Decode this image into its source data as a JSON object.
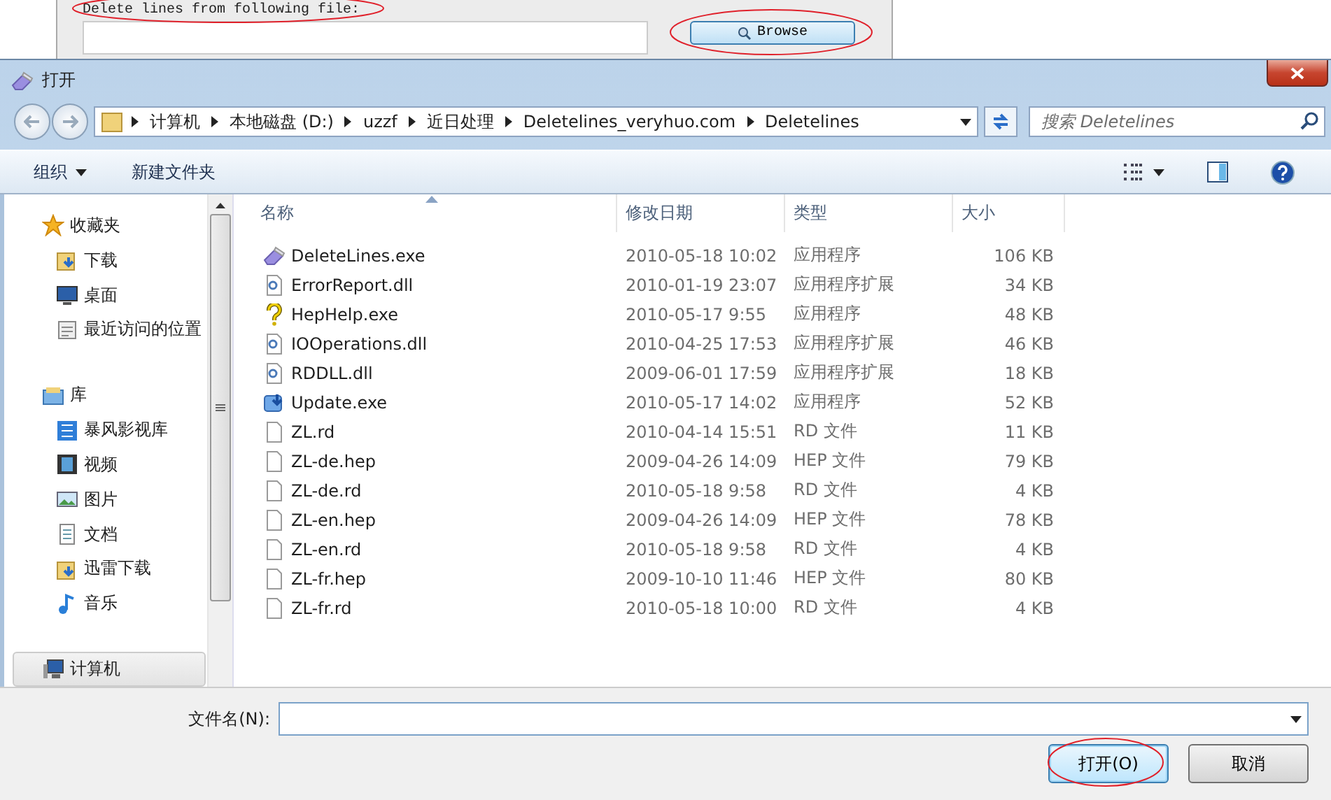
{
  "background_app": {
    "label": "Delete lines from following file:",
    "label_circled": true,
    "browse_button": "Browse",
    "browse_circled": true
  },
  "dialog": {
    "title": "打开",
    "address": [
      "计算机",
      "本地磁盘 (D:)",
      "uzzf",
      "近日处理",
      "Deletelines_veryhuo.com",
      "Deletelines"
    ],
    "search": {
      "placeholder": "搜索 Deletelines"
    },
    "toolbar": {
      "organize": "组织",
      "new_folder": "新建文件夹"
    },
    "nav": [
      {
        "label": "收藏夹",
        "kind": "star",
        "selected": false,
        "children": [
          {
            "label": "下载",
            "kind": "download",
            "selected": false
          },
          {
            "label": "桌面",
            "kind": "desktop",
            "selected": false
          },
          {
            "label": "最近访问的位置",
            "kind": "recent",
            "selected": false
          }
        ]
      },
      {
        "label": "库",
        "kind": "library",
        "selected": false,
        "children": [
          {
            "label": "暴风影视库",
            "kind": "video",
            "selected": false
          },
          {
            "label": "视频",
            "kind": "film",
            "selected": false
          },
          {
            "label": "图片",
            "kind": "image",
            "selected": false
          },
          {
            "label": "文档",
            "kind": "document",
            "selected": false
          },
          {
            "label": "迅雷下载",
            "kind": "download",
            "selected": false
          },
          {
            "label": "音乐",
            "kind": "music",
            "selected": false
          }
        ]
      },
      {
        "label": "计算机",
        "kind": "computer",
        "selected": true
      }
    ],
    "columns": [
      {
        "label": "名称",
        "sorted": true
      },
      {
        "label": "修改日期",
        "sorted": false
      },
      {
        "label": "类型",
        "sorted": false
      },
      {
        "label": "大小",
        "sorted": false
      }
    ],
    "files": [
      {
        "name": "DeleteLines.exe",
        "modified": "2010-05-18 10:02",
        "type": "应用程序",
        "size": "106 KB",
        "kind": "eraser"
      },
      {
        "name": "ErrorReport.dll",
        "modified": "2010-01-19 23:07",
        "type": "应用程序扩展",
        "size": "34 KB",
        "kind": "dll"
      },
      {
        "name": "HepHelp.exe",
        "modified": "2010-05-17 9:55",
        "type": "应用程序",
        "size": "48 KB",
        "kind": "help"
      },
      {
        "name": "IOOperations.dll",
        "modified": "2010-04-25 17:53",
        "type": "应用程序扩展",
        "size": "46 KB",
        "kind": "dll"
      },
      {
        "name": "RDDLL.dll",
        "modified": "2009-06-01 17:59",
        "type": "应用程序扩展",
        "size": "18 KB",
        "kind": "dll"
      },
      {
        "name": "Update.exe",
        "modified": "2010-05-17 14:02",
        "type": "应用程序",
        "size": "52 KB",
        "kind": "update"
      },
      {
        "name": "ZL.rd",
        "modified": "2010-04-14 15:51",
        "type": "RD 文件",
        "size": "11 KB",
        "kind": "blank"
      },
      {
        "name": "ZL-de.hep",
        "modified": "2009-04-26 14:09",
        "type": "HEP 文件",
        "size": "79 KB",
        "kind": "blank"
      },
      {
        "name": "ZL-de.rd",
        "modified": "2010-05-18 9:58",
        "type": "RD 文件",
        "size": "4 KB",
        "kind": "blank"
      },
      {
        "name": "ZL-en.hep",
        "modified": "2009-04-26 14:09",
        "type": "HEP 文件",
        "size": "78 KB",
        "kind": "blank"
      },
      {
        "name": "ZL-en.rd",
        "modified": "2010-05-18 9:58",
        "type": "RD 文件",
        "size": "4 KB",
        "kind": "blank"
      },
      {
        "name": "ZL-fr.hep",
        "modified": "2009-10-10 11:46",
        "type": "HEP 文件",
        "size": "80 KB",
        "kind": "blank"
      },
      {
        "name": "ZL-fr.rd",
        "modified": "2010-05-18 10:00",
        "type": "RD 文件",
        "size": "4 KB",
        "kind": "blank"
      }
    ],
    "filename_label": "文件名(N):",
    "buttons": [
      {
        "label": "打开(O)",
        "kind": "primary",
        "circled": true
      },
      {
        "label": "取消",
        "kind": "default",
        "circled": false
      }
    ]
  }
}
